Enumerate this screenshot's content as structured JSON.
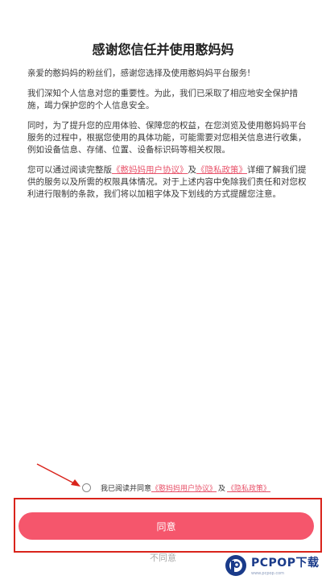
{
  "dialog": {
    "title": "感谢您信任并使用憨妈妈",
    "greeting": "亲爱的憨妈妈的粉丝们，感谢您选择及使用憨妈妈平台服务!",
    "para1": "我们深知个人信息对您的重要性。为此，我们已采取了相应地安全保护措施，竭力保护您的个人信息安全。",
    "para2": "同时，为了提升您的应用体验、保障您的权益，在您浏览及使用憨妈妈平台服务的过程中，根据您使用的具体功能，可能需要对您相关信息进行收集，例如设备信息、存储、位置、设备标识码等相关权限。",
    "para3_prefix": "您可以通过阅读完整版",
    "user_agreement_link": "《憨妈妈用户协议》",
    "and": "及",
    "privacy_link": "《隐私政策》",
    "para3_suffix": "详细了解我们提供的服务以及所需的权限具体情况。对于上述内容中免除我们责任和对您权利进行限制的条款，我们将以加粗字体及下划线的方式提醒您注意。"
  },
  "consent": {
    "prefix": "我已阅读并同意",
    "user_agreement_link": "《憨妈妈用户协议》",
    "and": "及",
    "privacy_link": "《隐私政策》"
  },
  "buttons": {
    "agree": "同意",
    "disagree": "不同意"
  },
  "watermark": {
    "brand": "PCPOP下载",
    "sub": "www.pcpop.com"
  },
  "colors": {
    "accent": "#f5566c",
    "link": "#e8546b",
    "annotation": "#d9231b"
  }
}
